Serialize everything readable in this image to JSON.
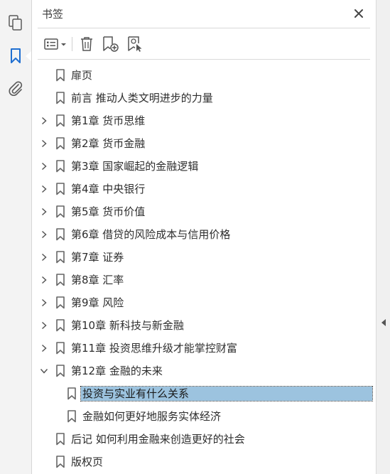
{
  "panel": {
    "title": "书签",
    "close_icon": "close-icon"
  },
  "leftbar": {
    "items": [
      {
        "icon": "pages-icon"
      },
      {
        "icon": "bookmark-icon",
        "active": true
      },
      {
        "icon": "attachment-icon"
      }
    ]
  },
  "toolbar": {
    "options_icon": "options-list-icon",
    "delete_icon": "trash-icon",
    "new_bookmark_icon": "new-bookmark-icon",
    "find_bookmark_icon": "find-current-bookmark-icon"
  },
  "bookmarks": [
    {
      "label": "扉页",
      "level": 0,
      "expander": "none"
    },
    {
      "label": "前言 推动人类文明进步的力量",
      "level": 0,
      "expander": "none"
    },
    {
      "label": "第1章 货币思维",
      "level": 0,
      "expander": "collapsed"
    },
    {
      "label": "第2章 货币金融",
      "level": 0,
      "expander": "collapsed"
    },
    {
      "label": "第3章 国家崛起的金融逻辑",
      "level": 0,
      "expander": "collapsed"
    },
    {
      "label": "第4章 中央银行",
      "level": 0,
      "expander": "collapsed"
    },
    {
      "label": "第5章 货币价值",
      "level": 0,
      "expander": "collapsed"
    },
    {
      "label": "第6章 借贷的风险成本与信用价格",
      "level": 0,
      "expander": "collapsed"
    },
    {
      "label": "第7章 证券",
      "level": 0,
      "expander": "collapsed"
    },
    {
      "label": "第8章 汇率",
      "level": 0,
      "expander": "collapsed"
    },
    {
      "label": "第9章 风险",
      "level": 0,
      "expander": "collapsed"
    },
    {
      "label": "第10章 新科技与新金融",
      "level": 0,
      "expander": "collapsed"
    },
    {
      "label": "第11章 投资思维升级才能掌控财富",
      "level": 0,
      "expander": "collapsed"
    },
    {
      "label": "第12章 金融的未来",
      "level": 0,
      "expander": "expanded"
    },
    {
      "label": "投资与实业有什么关系",
      "level": 1,
      "expander": "none",
      "selected": true
    },
    {
      "label": "金融如何更好地服务实体经济",
      "level": 1,
      "expander": "none"
    },
    {
      "label": "后记 如何利用金融来创造更好的社会",
      "level": 0,
      "expander": "none"
    },
    {
      "label": "版权页",
      "level": 0,
      "expander": "none"
    }
  ],
  "colors": {
    "accent": "#1f6fd1",
    "selection": "#9cc3df"
  }
}
